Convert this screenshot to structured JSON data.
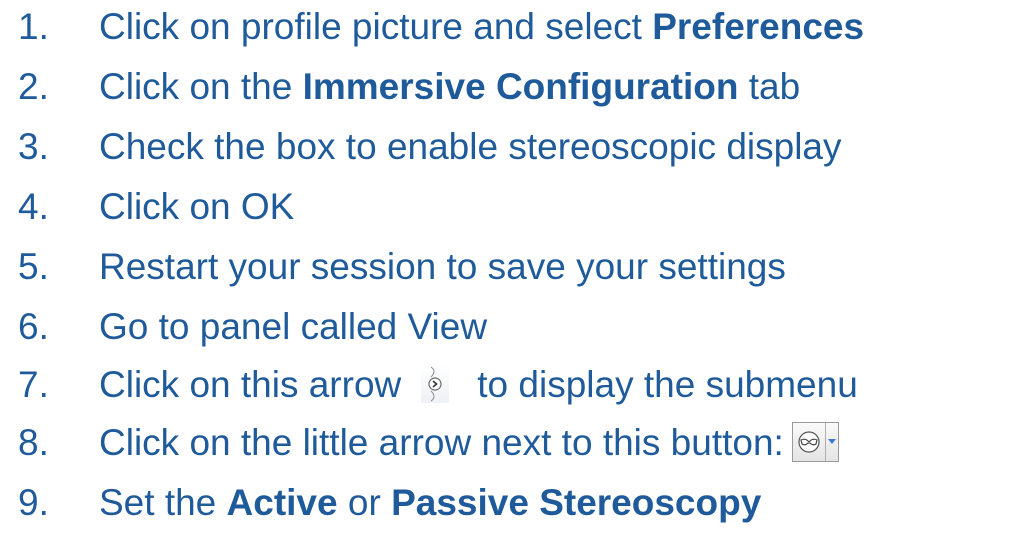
{
  "steps": [
    {
      "num": "1.",
      "parts": [
        "Click on profile picture and select ",
        "Preferences"
      ]
    },
    {
      "num": "2.",
      "parts": [
        "Click on the ",
        "Immersive Configuration",
        " tab"
      ]
    },
    {
      "num": "3.",
      "parts": [
        "Check the box to enable stereoscopic display"
      ]
    },
    {
      "num": "4.",
      "parts": [
        "Click on OK"
      ]
    },
    {
      "num": "5.",
      "parts": [
        "Restart your session to save your settings"
      ]
    },
    {
      "num": "6.",
      "parts": [
        "Go to panel called View"
      ]
    },
    {
      "num": "7.",
      "parts": [
        "Click on this arrow",
        "to display the submenu"
      ]
    },
    {
      "num": "8.",
      "parts": [
        "Click on the little arrow next to this button:"
      ]
    },
    {
      "num": "9.",
      "parts": [
        "Set the ",
        "Active",
        " or ",
        "Passive Stereoscopy"
      ]
    }
  ],
  "icons": {
    "submenu_arrow": "chevron-right-circle-icon",
    "stereo_button": "stereo-glasses-icon",
    "dropdown_arrow": "caret-down-icon"
  },
  "colors": {
    "text": "#1f5a9a",
    "icon_blue": "#3a7bd5"
  }
}
